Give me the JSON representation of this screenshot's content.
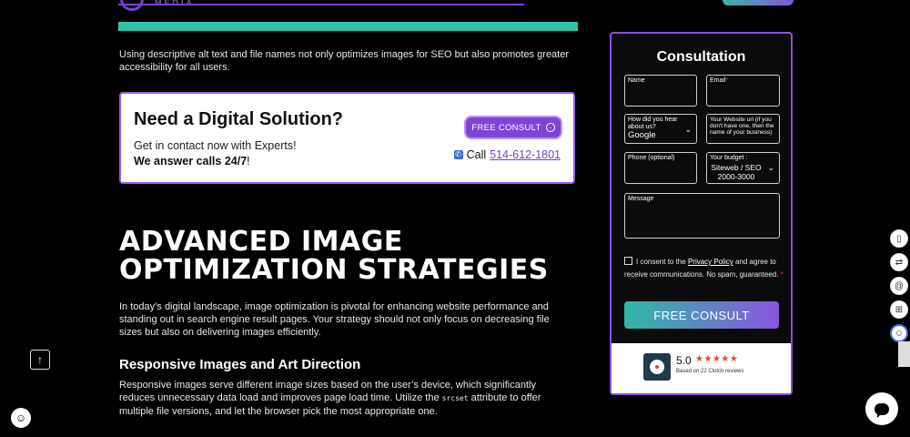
{
  "header": {
    "logo_text": "MEDIA"
  },
  "intro": "Using descriptive alt text and file names not only optimizes images for SEO but also promotes greater accessibility for all users.",
  "cta": {
    "title": "Need a Digital Solution?",
    "subtitle": "Get in contact now with Experts!",
    "calls_bold": "We answer calls 24/7",
    "calls_tail": "!",
    "button_label": "FREE CONSULT",
    "call_label": "Call",
    "phone": "514-612-1801"
  },
  "article": {
    "heading_line1": "ADVANCED IMAGE",
    "heading_line2": "OPTIMIZATION STRATEGIES",
    "para1": "In today’s digital landscape, image optimization is pivotal for enhancing website performance and standing out in search engine result pages. Your strategy should not only focus on decreasing file sizes but also on delivering images efficiently.",
    "subheading": "Responsive Images and Art Direction",
    "para2_a": "Responsive images serve different image sizes based on the user’s device, which significantly reduces unnecessary data load and improves page load time. Utilize the ",
    "para2_code": "srcset",
    "para2_b": " attribute to offer multiple file versions, and let the browser pick the most appropriate one."
  },
  "form": {
    "title": "Consultation",
    "name_label": "Name",
    "email_label": "Email",
    "hear_label": "How did you hear about us?",
    "hear_value": "Google",
    "url_label": "Your Website url (if you don't have one, then the name of your business)",
    "phone_label": "Phone (optional)",
    "budget_label": "Your budget :",
    "budget_value": "Siteweb / SEO 2000-3000",
    "message_label": "Message",
    "consent_pre": "I consent to the ",
    "consent_link": "Privacy Policy",
    "consent_post": " and agree to receive communications. No spam, guaranteed.",
    "submit_label": "FREE CONSULT"
  },
  "clutch": {
    "score": "5.0",
    "stars": "★★★★★",
    "reviews": "Based on 22 Clutch reviews"
  },
  "colors": {
    "accent_purple": "#7f43d6",
    "teal": "#2ec4a6"
  },
  "icons": [
    "arrow-up-icon",
    "cookie-icon",
    "book-icon",
    "translate-icon",
    "at-icon",
    "grid-icon",
    "accessibility-icon",
    "chat-icon",
    "phone-icon"
  ]
}
